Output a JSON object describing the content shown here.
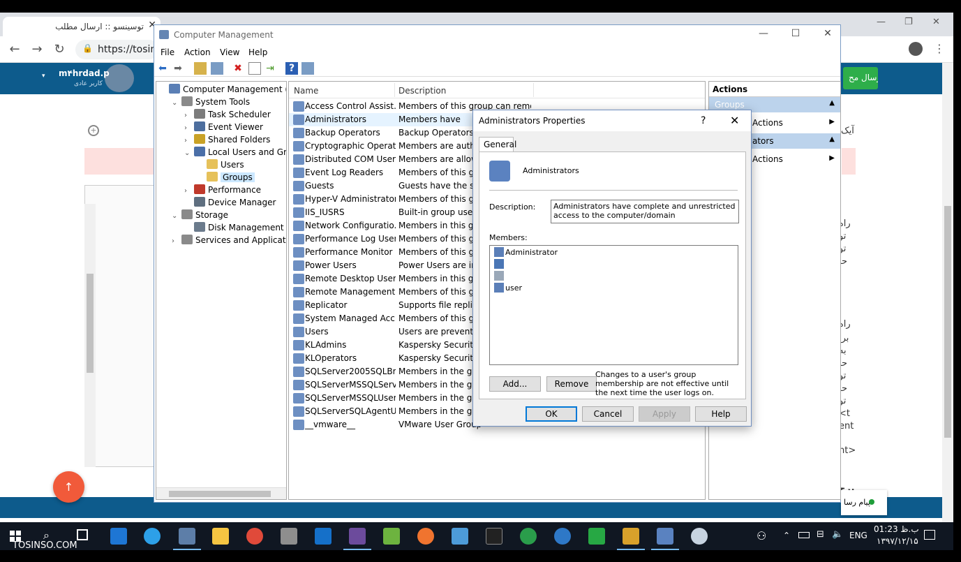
{
  "browser": {
    "active_tab": "توسینسو :: ارسال مطلب",
    "url": "https://tosins",
    "user_name": "m۴hrdad.p",
    "user_role": "کاربر عادی",
    "send_button": "ارسال مح",
    "side_texts": [
      "آیک",
      "راه",
      "تو",
      "تو",
      "حا",
      "راه",
      "برا",
      "به",
      "حا",
      "تو",
      "حا",
      "تو",
      "<t",
      "ent",
      "nt>",
      "برچ"
    ],
    "bottom_status": "پیام رسا"
  },
  "cm": {
    "title": "Computer Management",
    "menu": [
      "File",
      "Action",
      "View",
      "Help"
    ],
    "tree": [
      {
        "label": "Computer Management (Local",
        "indent": 0,
        "exp": "",
        "color": "#5a7fb5"
      },
      {
        "label": "System Tools",
        "indent": 1,
        "exp": "v",
        "color": "#8a8a8a"
      },
      {
        "label": "Task Scheduler",
        "indent": 2,
        "exp": ">",
        "color": "#7c7c7c"
      },
      {
        "label": "Event Viewer",
        "indent": 2,
        "exp": ">",
        "color": "#4d6e9e"
      },
      {
        "label": "Shared Folders",
        "indent": 2,
        "exp": ">",
        "color": "#c9a227"
      },
      {
        "label": "Local Users and Groups",
        "indent": 2,
        "exp": "v",
        "color": "#4b6fa8"
      },
      {
        "label": "Users",
        "indent": 3,
        "exp": "",
        "color": "#e6c15a"
      },
      {
        "label": "Groups",
        "indent": 3,
        "exp": "",
        "color": "#e6c15a"
      },
      {
        "label": "Performance",
        "indent": 2,
        "exp": ">",
        "color": "#c0392b"
      },
      {
        "label": "Device Manager",
        "indent": 2,
        "exp": "",
        "color": "#5f6f80"
      },
      {
        "label": "Storage",
        "indent": 1,
        "exp": "v",
        "color": "#8a8a8a"
      },
      {
        "label": "Disk Management",
        "indent": 2,
        "exp": "",
        "color": "#6b7b8c"
      },
      {
        "label": "Services and Applications",
        "indent": 1,
        "exp": ">",
        "color": "#8a8a8a"
      }
    ],
    "list_headers": {
      "name": "Name",
      "description": "Description"
    },
    "groups": [
      {
        "name": "Access Control Assist...",
        "desc": "Members of this group can remot..."
      },
      {
        "name": "Administrators",
        "desc": "Members have"
      },
      {
        "name": "Backup Operators",
        "desc": "Backup Operators ca"
      },
      {
        "name": "Cryptographic Operat...",
        "desc": "Members are author"
      },
      {
        "name": "Distributed COM Users",
        "desc": "Members are allowe"
      },
      {
        "name": "Event Log Readers",
        "desc": "Members of this gro"
      },
      {
        "name": "Guests",
        "desc": "Guests have the sam"
      },
      {
        "name": "Hyper-V Administrators",
        "desc": "Members of this gro"
      },
      {
        "name": "IIS_IUSRS",
        "desc": "Built-in group used"
      },
      {
        "name": "Network Configuratio...",
        "desc": "Members in this gro"
      },
      {
        "name": "Performance Log Users",
        "desc": "Members of this gro"
      },
      {
        "name": "Performance Monitor ...",
        "desc": "Members of this gro"
      },
      {
        "name": "Power Users",
        "desc": "Power Users are incl"
      },
      {
        "name": "Remote Desktop Users",
        "desc": "Members in this grou"
      },
      {
        "name": "Remote Management...",
        "desc": "Members of this gro"
      },
      {
        "name": "Replicator",
        "desc": "Supports file replicat"
      },
      {
        "name": "System Managed Acc...",
        "desc": "Members of this gro"
      },
      {
        "name": "Users",
        "desc": "Users are prevented"
      },
      {
        "name": "KLAdmins",
        "desc": "Kaspersky Security C"
      },
      {
        "name": "KLOperators",
        "desc": "Kaspersky Security C"
      },
      {
        "name": "SQLServer2005SQLBro...",
        "desc": "Members in the grou"
      },
      {
        "name": "SQLServerMSSQLServ...",
        "desc": "Members in the grou"
      },
      {
        "name": "SQLServerMSSQLUser...",
        "desc": "Members in the grou"
      },
      {
        "name": "SQLServerSQLAgentU...",
        "desc": "Members in the grou"
      },
      {
        "name": "__vmware__",
        "desc": "VMware User Group"
      }
    ],
    "actions_title": "Actions",
    "action_sections": [
      "Groups",
      "ators"
    ],
    "more_actions": "Actions"
  },
  "dialog": {
    "title": "Administrators Properties",
    "help_glyph": "?",
    "tab": "General",
    "group_name": "Administrators",
    "description_label": "Description:",
    "description": "Administrators have complete and unrestricted access to the computer/domain",
    "members_label": "Members:",
    "members": [
      "Administrator",
      "",
      "",
      "user"
    ],
    "add_button": "Add...",
    "remove_button": "Remove",
    "note": "Changes to a user's group membership are not effective until the next time the user logs on.",
    "ok": "OK",
    "cancel": "Cancel",
    "apply": "Apply",
    "help": "Help"
  },
  "taskbar": {
    "language": "ENG",
    "time": "01:23 ب.ظ",
    "date": "۱۳۹۷/۱۲/۱۵"
  },
  "watermark": "TOSINSO.COM"
}
